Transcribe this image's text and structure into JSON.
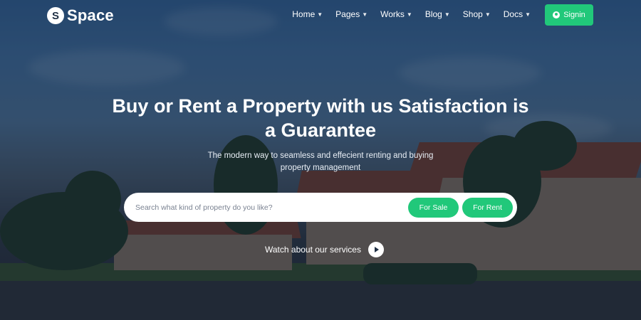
{
  "brand": {
    "badge": "S",
    "name": "Space"
  },
  "nav": {
    "items": [
      {
        "label": "Home"
      },
      {
        "label": "Pages"
      },
      {
        "label": "Works"
      },
      {
        "label": "Blog"
      },
      {
        "label": "Shop"
      },
      {
        "label": "Docs"
      }
    ],
    "caret_icon": "chevron-down-icon",
    "signin_label": "Signin",
    "signin_icon": "user-circle-icon"
  },
  "hero": {
    "headline_line1": "Buy or Rent a Property with us Satisfaction is",
    "headline_line2": "a Guarantee",
    "subtext_line1": "The modern way to seamless and effecient renting and buying",
    "subtext_line2": "property management"
  },
  "search": {
    "placeholder": "Search what kind of property do you like?",
    "value": "",
    "sale_label": "For Sale",
    "rent_label": "For Rent"
  },
  "video": {
    "label": "Watch about our services",
    "icon": "play-icon"
  },
  "colors": {
    "accent": "#21c87a",
    "text": "#ffffff",
    "overlay": "#142034"
  }
}
